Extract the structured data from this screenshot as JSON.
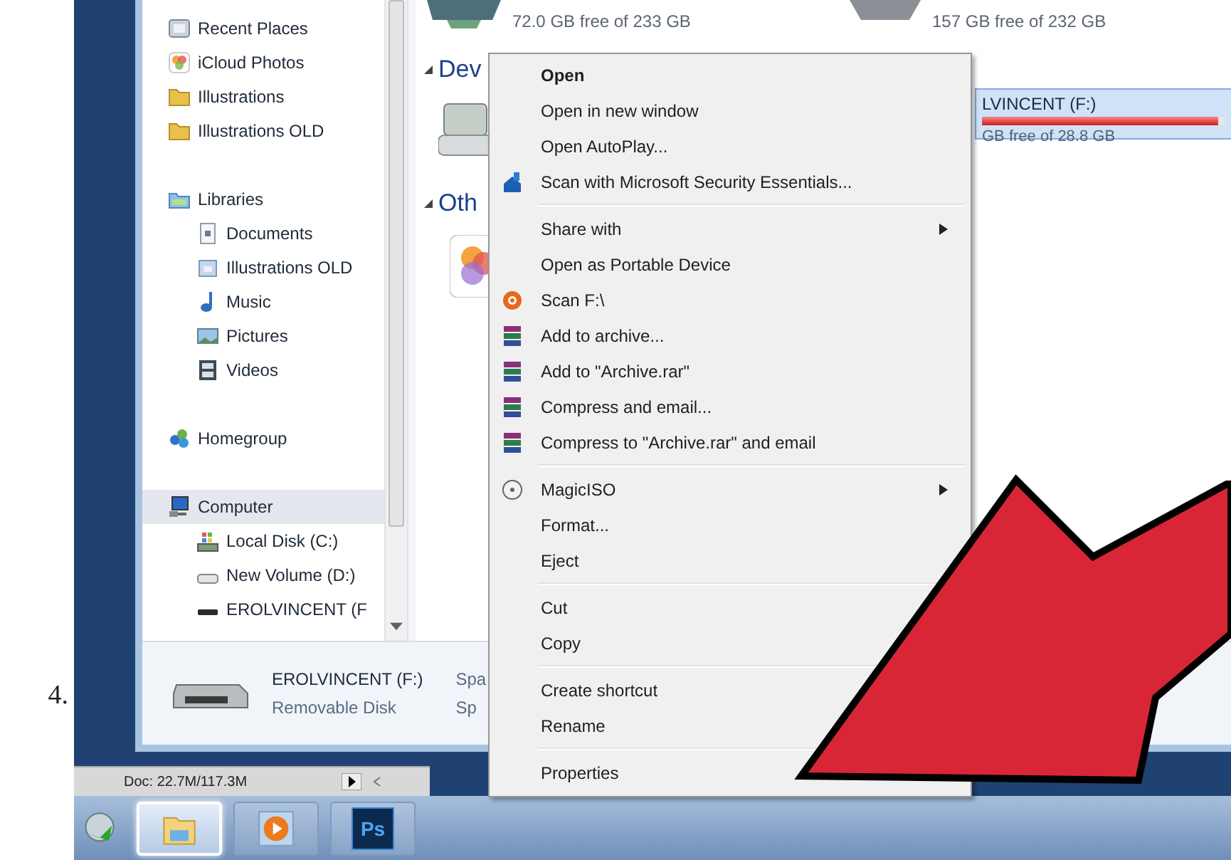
{
  "step_number": "4.",
  "nav_pane": {
    "items": [
      {
        "label": "Recent Places",
        "kind": "recent",
        "selected": false
      },
      {
        "label": "iCloud Photos",
        "kind": "photos",
        "selected": false
      },
      {
        "label": "Illustrations",
        "kind": "folder",
        "selected": false
      },
      {
        "label": "Illustrations OLD",
        "kind": "folder",
        "selected": false
      },
      {
        "label": "Libraries",
        "kind": "libraries",
        "selected": false,
        "children": [
          {
            "label": "Documents",
            "kind": "documents",
            "selected": false
          },
          {
            "label": "Illustrations OLD",
            "kind": "library",
            "selected": false
          },
          {
            "label": "Music",
            "kind": "music",
            "selected": false
          },
          {
            "label": "Pictures",
            "kind": "pictures",
            "selected": false
          },
          {
            "label": "Videos",
            "kind": "videos",
            "selected": false
          }
        ]
      },
      {
        "label": "Homegroup",
        "kind": "homegroup",
        "selected": false
      },
      {
        "label": "Computer",
        "kind": "computer",
        "selected": true,
        "children": [
          {
            "label": "Local Disk (C:)",
            "kind": "system-disk",
            "selected": false
          },
          {
            "label": "New Volume (D:)",
            "kind": "disk",
            "selected": false
          },
          {
            "label": "EROLVINCENT (F",
            "kind": "usb",
            "selected": false
          }
        ]
      }
    ]
  },
  "content": {
    "drives_top": [
      "72.0 GB free of 233 GB",
      "157 GB free of 232 GB"
    ],
    "section_1": "Dev",
    "section_2": "Oth",
    "removable_drive": {
      "name": "LVINCENT (F:)",
      "level": 0.97,
      "free": "GB free of 28.8 GB",
      "selected": true
    }
  },
  "details_pane": {
    "name": "EROLVINCENT (F:)",
    "type": "Removable Disk",
    "column_3": [
      "Spa",
      "Sp"
    ]
  },
  "context_menu": {
    "groups": [
      [
        {
          "label": "Open",
          "kind": "plain",
          "default": true,
          "submenu": false
        },
        {
          "label": "Open in new window",
          "kind": "plain",
          "default": false,
          "submenu": false
        },
        {
          "label": "Open AutoPlay...",
          "kind": "plain",
          "default": false,
          "submenu": false
        },
        {
          "label": "Scan with Microsoft Security Essentials...",
          "kind": "security",
          "default": false,
          "submenu": false
        }
      ],
      [
        {
          "label": "Share with",
          "kind": "plain",
          "default": false,
          "submenu": true
        },
        {
          "label": "Open as Portable Device",
          "kind": "plain",
          "default": false,
          "submenu": false
        },
        {
          "label": "Scan F:\\",
          "kind": "antivirus",
          "default": false,
          "submenu": false
        },
        {
          "label": "Add to archive...",
          "kind": "archive",
          "default": false,
          "submenu": false
        },
        {
          "label": "Add to \"Archive.rar\"",
          "kind": "archive",
          "default": false,
          "submenu": false
        },
        {
          "label": "Compress and email...",
          "kind": "archive",
          "default": false,
          "submenu": false
        },
        {
          "label": "Compress to \"Archive.rar\" and email",
          "kind": "archive",
          "default": false,
          "submenu": false
        }
      ],
      [
        {
          "label": "MagicISO",
          "kind": "disc",
          "default": false,
          "submenu": true
        },
        {
          "label": "Format...",
          "kind": "plain",
          "default": false,
          "submenu": false
        },
        {
          "label": "Eject",
          "kind": "plain",
          "default": false,
          "submenu": false
        }
      ],
      [
        {
          "label": "Cut",
          "kind": "plain",
          "default": false,
          "submenu": false
        },
        {
          "label": "Copy",
          "kind": "plain",
          "default": false,
          "submenu": false
        }
      ],
      [
        {
          "label": "Create shortcut",
          "kind": "plain",
          "default": false,
          "submenu": false
        },
        {
          "label": "Rename",
          "kind": "plain",
          "default": false,
          "submenu": false
        }
      ],
      [
        {
          "label": "Properties",
          "kind": "plain",
          "default": false,
          "submenu": false
        }
      ]
    ]
  },
  "photoshop_status": {
    "doc": "Doc: 22.7M/117.3M"
  },
  "taskbar": {
    "items": [
      {
        "kind": "start"
      },
      {
        "kind": "explorer",
        "active": true
      },
      {
        "kind": "media",
        "active": false
      },
      {
        "kind": "photoshop",
        "label": "Ps",
        "active": false
      }
    ]
  }
}
